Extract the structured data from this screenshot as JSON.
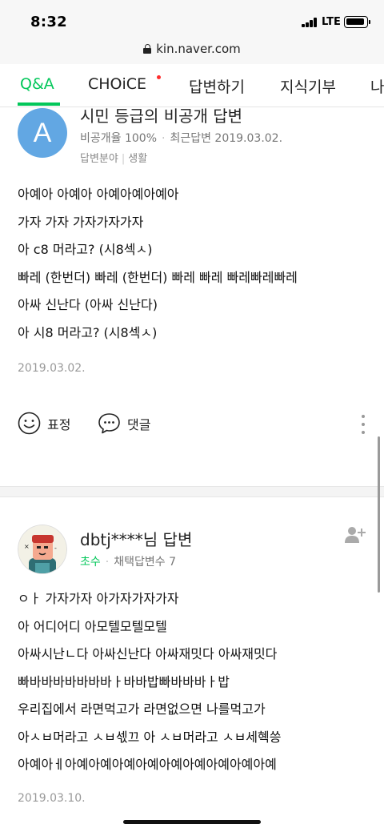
{
  "status_bar": {
    "time": "8:32",
    "network": "LTE"
  },
  "browser": {
    "url": "kin.naver.com"
  },
  "tabs": [
    {
      "label": "Q&A",
      "active": true
    },
    {
      "label": "CHOiCE",
      "has_new": true
    },
    {
      "label": "답변하기"
    },
    {
      "label": "지식기부"
    },
    {
      "label": "나"
    }
  ],
  "answer1": {
    "avatar_letter": "A",
    "title": "시민 등급의 비공개 답변",
    "privacy_rate": "비공개율 100%",
    "recent_answer": "최근답변 2019.03.02.",
    "field_label": "답변분야",
    "field_value": "생활",
    "lines": [
      "아예아 아예아 아예아예아예아",
      "가자 가자 가자가자가자",
      "아 c8 머라고? (시8섹ㅅ)",
      "빠레 (한번더) 빠레 (한번더) 빠레 빠레 빠레빠레빠레",
      "아싸 신난다 (아싸 신난다)",
      "아 시8 머라고? (시8섹ㅅ)"
    ],
    "date": "2019.03.02.",
    "reaction_label": "표정",
    "comment_label": "댓글"
  },
  "answer2": {
    "author": "dbtj****님 답변",
    "grade": "초수",
    "adopted_count": "채택답변수 7",
    "lines": [
      "ㅇㅏ 가자가자 아가자가자가자",
      "아 어디어디 아모텔모텔모텔",
      "아싸시난ㄴ다 아싸신난다 아싸재밋다 아싸재밋다",
      "빠바바바바바바바ㅏ바바밥빠바바바ㅏ밥",
      "우리집에서 라면먹고가 라면없으면 나를먹고가",
      "아ㅅㅂ머라고 ㅅㅂ섻끄 아 ㅅㅂ머라고 ㅅㅂ세혝씅",
      "아예아ㅔ아예아예아예아예아예아예아예아예아예"
    ],
    "date": "2019.03.10."
  },
  "colors": {
    "accent": "#03c75a",
    "avatar_blue": "#62a7e3",
    "new_dot": "#ff2d2d"
  },
  "icons": [
    "lock-icon",
    "smile-icon",
    "comment-icon",
    "more-icon",
    "add-user-icon"
  ]
}
